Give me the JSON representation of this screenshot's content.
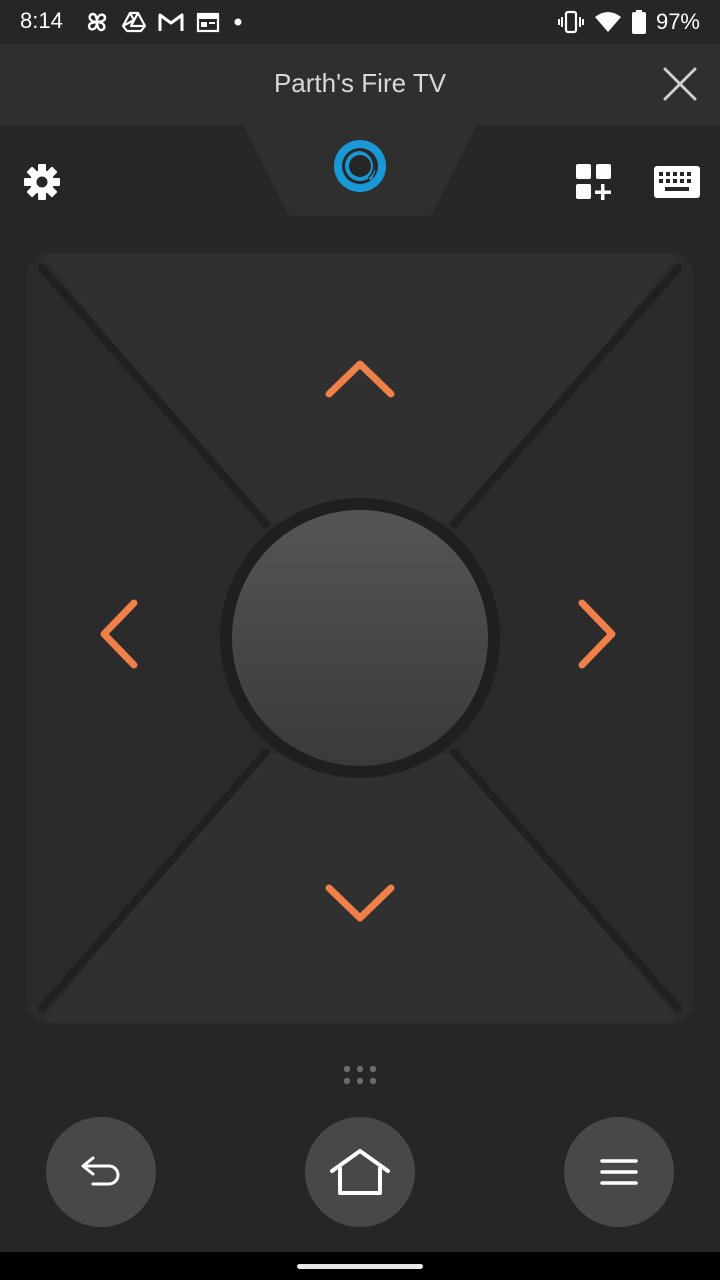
{
  "status_bar": {
    "time": "8:14",
    "left_icons": [
      "fan-icon",
      "drive-icon",
      "gmail-icon",
      "calendar-icon",
      "notification-dot-icon"
    ],
    "right_icons": [
      "vibrate-icon",
      "wifi-icon",
      "battery-icon"
    ],
    "battery_text": "97%"
  },
  "header": {
    "title": "Parth's Fire TV",
    "close_icon": "close-icon"
  },
  "toolbar": {
    "settings_icon": "gear-icon",
    "alexa_icon": "alexa-icon",
    "apps_icon": "apps-add-icon",
    "keyboard_icon": "keyboard-icon"
  },
  "dpad": {
    "up_icon": "chevron-up-icon",
    "down_icon": "chevron-down-icon",
    "left_icon": "chevron-left-icon",
    "right_icon": "chevron-right-icon",
    "select_label": ""
  },
  "bottom_controls": {
    "back_icon": "back-arrow-icon",
    "home_icon": "home-icon",
    "menu_icon": "menu-icon",
    "handle_icon": "drag-handle-icon"
  },
  "colors": {
    "background": "#262626",
    "header": "#2f2f2f",
    "accent_orange": "#f0804a",
    "alexa_blue": "#1a98d5",
    "button_gray": "#484848"
  }
}
